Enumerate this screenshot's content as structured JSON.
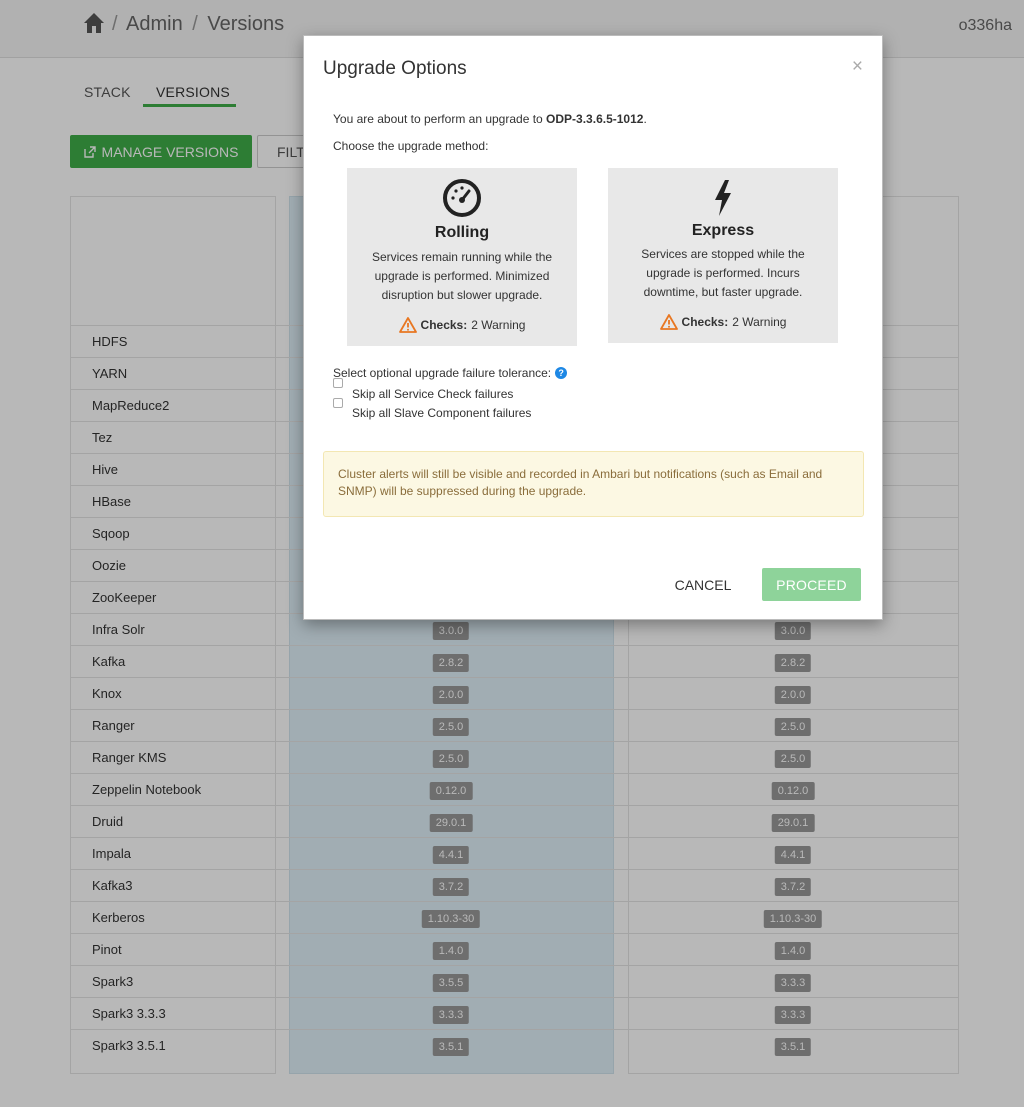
{
  "header": {
    "breadcrumb": [
      "Admin",
      "Versions"
    ],
    "separator": "/",
    "user": "o336ha"
  },
  "tabs": [
    {
      "label": "STACK",
      "active": false
    },
    {
      "label": "VERSIONS",
      "active": true
    }
  ],
  "toolbar": {
    "manage_label": "MANAGE VERSIONS",
    "filter_label": "FILT"
  },
  "services": [
    {
      "name": "HDFS",
      "v1": "",
      "v2": ""
    },
    {
      "name": "YARN",
      "v1": "",
      "v2": ""
    },
    {
      "name": "MapReduce2",
      "v1": "",
      "v2": ""
    },
    {
      "name": "Tez",
      "v1": "",
      "v2": ""
    },
    {
      "name": "Hive",
      "v1": "",
      "v2": ""
    },
    {
      "name": "HBase",
      "v1": "",
      "v2": ""
    },
    {
      "name": "Sqoop",
      "v1": "",
      "v2": ""
    },
    {
      "name": "Oozie",
      "v1": "",
      "v2": ""
    },
    {
      "name": "ZooKeeper",
      "v1": "",
      "v2": ""
    },
    {
      "name": "Infra Solr",
      "v1": "3.0.0",
      "v2": "3.0.0"
    },
    {
      "name": "Kafka",
      "v1": "2.8.2",
      "v2": "2.8.2"
    },
    {
      "name": "Knox",
      "v1": "2.0.0",
      "v2": "2.0.0"
    },
    {
      "name": "Ranger",
      "v1": "2.5.0",
      "v2": "2.5.0"
    },
    {
      "name": "Ranger KMS",
      "v1": "2.5.0",
      "v2": "2.5.0"
    },
    {
      "name": "Zeppelin Notebook",
      "v1": "0.12.0",
      "v2": "0.12.0"
    },
    {
      "name": "Druid",
      "v1": "29.0.1",
      "v2": "29.0.1"
    },
    {
      "name": "Impala",
      "v1": "4.4.1",
      "v2": "4.4.1"
    },
    {
      "name": "Kafka3",
      "v1": "3.7.2",
      "v2": "3.7.2"
    },
    {
      "name": "Kerberos",
      "v1": "1.10.3-30",
      "v2": "1.10.3-30"
    },
    {
      "name": "Pinot",
      "v1": "1.4.0",
      "v2": "1.4.0"
    },
    {
      "name": "Spark3",
      "v1": "3.5.5",
      "v2": "3.3.3"
    },
    {
      "name": "Spark3 3.3.3",
      "v1": "3.3.3",
      "v2": "3.3.3"
    },
    {
      "name": "Spark3 3.5.1",
      "v1": "3.5.1",
      "v2": "3.5.1"
    }
  ],
  "modal": {
    "title": "Upgrade Options",
    "close": "×",
    "intro_prefix": "You are about to perform an upgrade to ",
    "target_version": "ODP-3.3.6.5-1012",
    "intro_suffix": ".",
    "choose_label": "Choose the upgrade method:",
    "rolling": {
      "title": "Rolling",
      "description": "Services remain running while the upgrade is performed. Minimized disruption but slower upgrade.",
      "checks_label": "Checks:",
      "checks_value": "2 Warning"
    },
    "express": {
      "title": "Express",
      "description": "Services are stopped while the upgrade is performed. Incurs downtime, but faster upgrade.",
      "checks_label": "Checks:",
      "checks_value": "2 Warning"
    },
    "tolerance_label": "Select optional upgrade failure tolerance:",
    "help_glyph": "?",
    "options": [
      {
        "label": "Skip all Service Check failures",
        "checked": false
      },
      {
        "label": "Skip all Slave Component failures",
        "checked": false
      }
    ],
    "alert": "Cluster alerts will still be visible and recorded in Ambari but notifications (such as Email and SNMP) will be suppressed during the upgrade.",
    "cancel_label": "CANCEL",
    "proceed_label": "PROCEED"
  },
  "colors": {
    "accent_green": "#3fae49",
    "proceed_disabled": "#8ed39a",
    "warning_orange": "#e87722",
    "help_blue": "#1e88e5",
    "alert_bg": "#fcf8e3",
    "alert_text": "#8a6d3b"
  },
  "icons": {
    "home": "home-icon",
    "external": "external-link-icon",
    "rolling": "gauge-icon",
    "express": "lightning-icon",
    "warning": "warning-triangle-icon",
    "help": "help-circle-icon",
    "close": "close-icon"
  }
}
